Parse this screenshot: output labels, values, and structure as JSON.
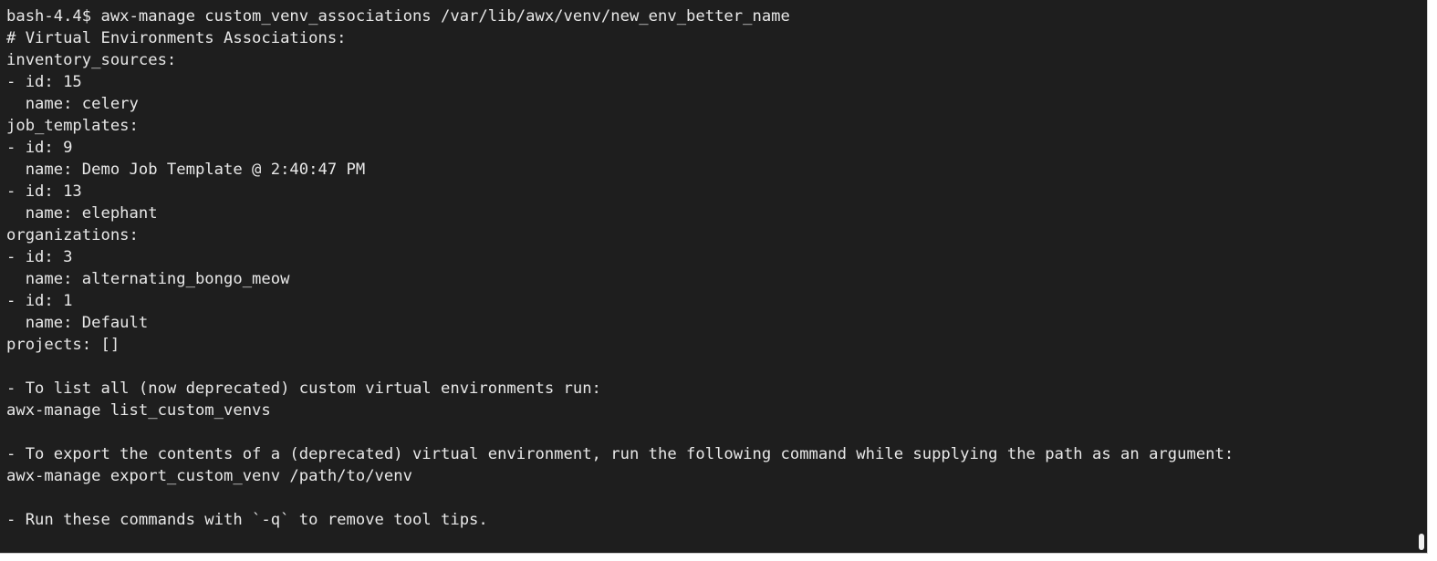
{
  "terminal": {
    "lines": [
      "bash-4.4$ awx-manage custom_venv_associations /var/lib/awx/venv/new_env_better_name",
      "# Virtual Environments Associations:",
      "inventory_sources:",
      "- id: 15",
      "  name: celery",
      "job_templates:",
      "- id: 9",
      "  name: Demo Job Template @ 2:40:47 PM",
      "- id: 13",
      "  name: elephant",
      "organizations:",
      "- id: 3",
      "  name: alternating_bongo_meow",
      "- id: 1",
      "  name: Default",
      "projects: []",
      "",
      "- To list all (now deprecated) custom virtual environments run:",
      "awx-manage list_custom_venvs",
      "",
      "- To export the contents of a (deprecated) virtual environment, run the following command while supplying the path as an argument:",
      "awx-manage export_custom_venv /path/to/venv",
      "",
      "- Run these commands with `-q` to remove tool tips."
    ]
  },
  "colors": {
    "background": "#1e1e1e",
    "text": "#e8e8e8",
    "scroll_thumb": "#f0f0f0"
  }
}
